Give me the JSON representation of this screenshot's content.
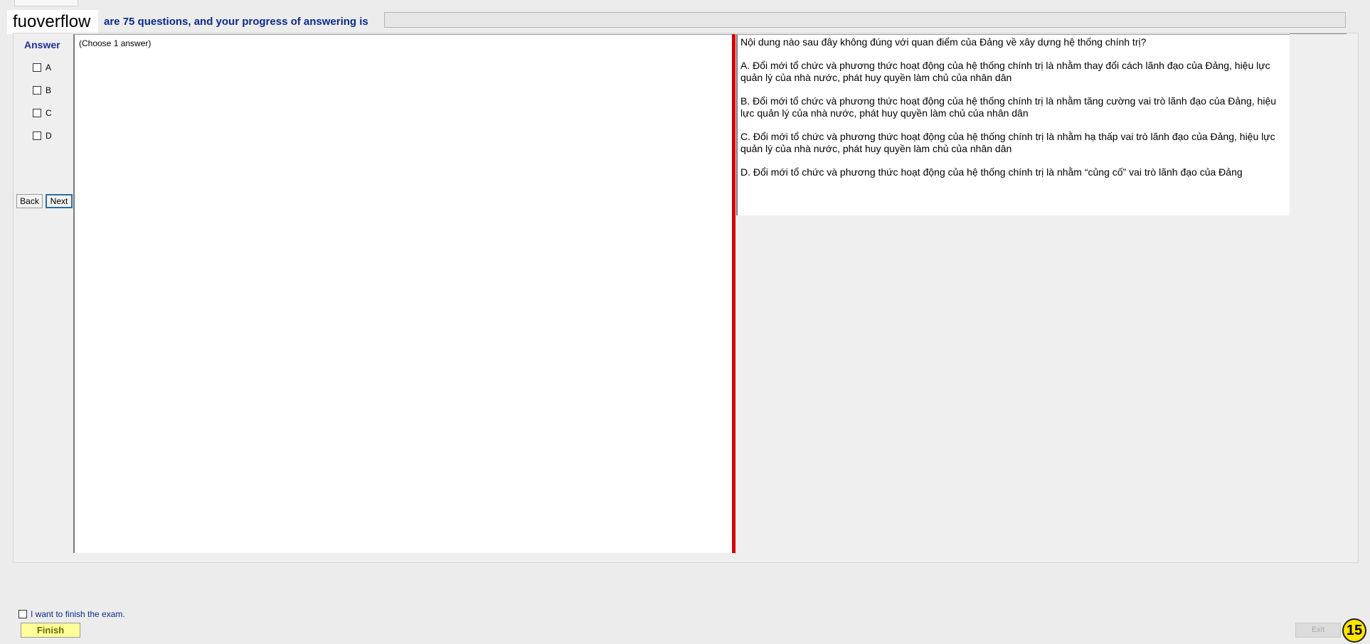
{
  "brand": "fuoverflow",
  "progress": {
    "text": "are 75 questions, and your progress of answering is",
    "value": 0
  },
  "answer_panel": {
    "title": "Answer",
    "options": [
      "A",
      "B",
      "C",
      "D"
    ],
    "back_label": "Back",
    "next_label": "Next"
  },
  "choose_hint": "(Choose 1 answer)",
  "question": {
    "stem": "Nội dung nào sau đây không đúng với quan điểm của Đảng về xây dựng hệ thống chính trị?",
    "options": [
      "A.  Đổi mới tổ chức và phương thức hoạt động của hệ thống chính trị là nhằm thay đổi cách lãnh đạo của Đảng, hiệu lực quản lý của nhà nước, phát huy quyền làm chủ của nhân dân",
      "B.  Đổi mới tổ chức và phương thức hoạt động của hệ thống chính trị là nhằm tăng cường vai trò lãnh đạo của Đảng, hiệu lực quản lý của nhà nước, phát huy quyền làm chủ của nhân dân",
      "C.  Đổi mới tổ chức và phương thức hoạt động của hệ thống chính trị là nhằm hạ thấp vai trò lãnh đạo của Đảng, hiệu lực quản lý của nhà nước, phát huy quyền làm chủ của nhân dân",
      "D.  Đổi mới tổ chức và phương thức hoạt động của hệ thống chính trị là nhằm “củng cố” vai trò lãnh đạo của Đảng"
    ]
  },
  "footer": {
    "finish_check_label": "I want to finish the exam.",
    "finish_label": "Finish",
    "exit_label": "Exit",
    "badge": "15"
  },
  "colors": {
    "splitter": "#d60000",
    "finish_bg": "#ffff99",
    "badge_bg": "#ffe500",
    "label_blue": "#0b2a8c"
  }
}
